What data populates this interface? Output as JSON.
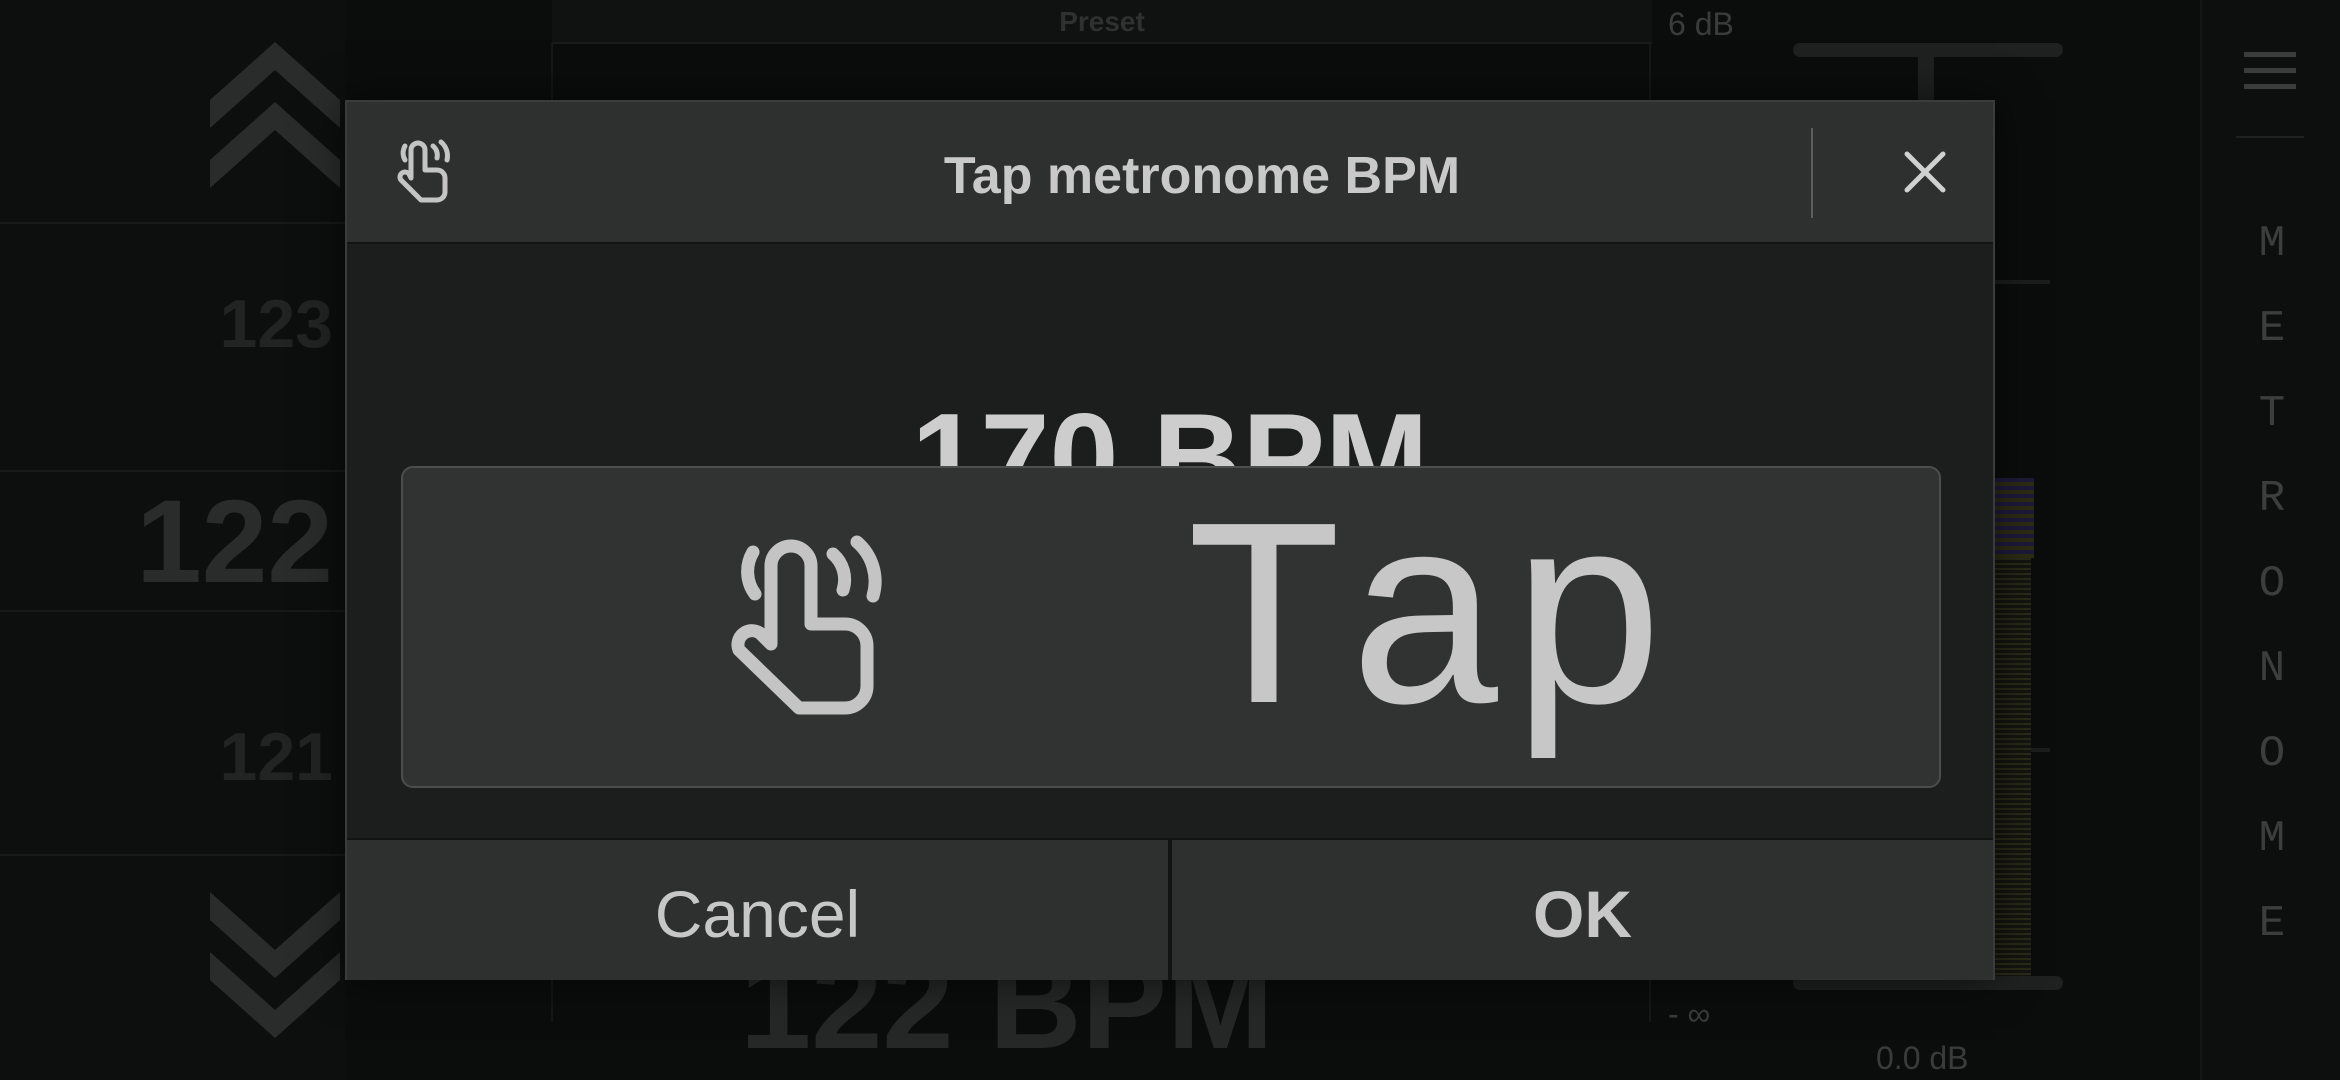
{
  "background": {
    "preset_label": "Preset",
    "bpm_list": {
      "items": [
        "123",
        "122",
        "121"
      ],
      "selected_index": 1
    },
    "main_bpm_text": "122 BPM",
    "gain": {
      "max_label": "6 dB",
      "min_label": "- ∞",
      "value_label": "0.0 dB"
    },
    "right_rail": {
      "menu_icon": "hamburger-menu-icon",
      "vertical_label": [
        "M",
        "E",
        "T",
        "R",
        "O",
        "N",
        "O",
        "M",
        "E"
      ]
    }
  },
  "dialog": {
    "header_icon": "tap-gesture-icon",
    "title": "Tap metronome BPM",
    "close_icon": "close-icon",
    "bpm_display": "170 BPM",
    "tap_button": {
      "icon": "tap-gesture-icon",
      "label": "Tap"
    },
    "cancel_label": "Cancel",
    "ok_label": "OK"
  },
  "colors": {
    "dialog_background": "#1c1d1d",
    "header_background": "#2e2f2f",
    "text": "#c9c9c9",
    "meter_yellow": "#2a2a18",
    "meter_blue": "#1d1a3a"
  }
}
